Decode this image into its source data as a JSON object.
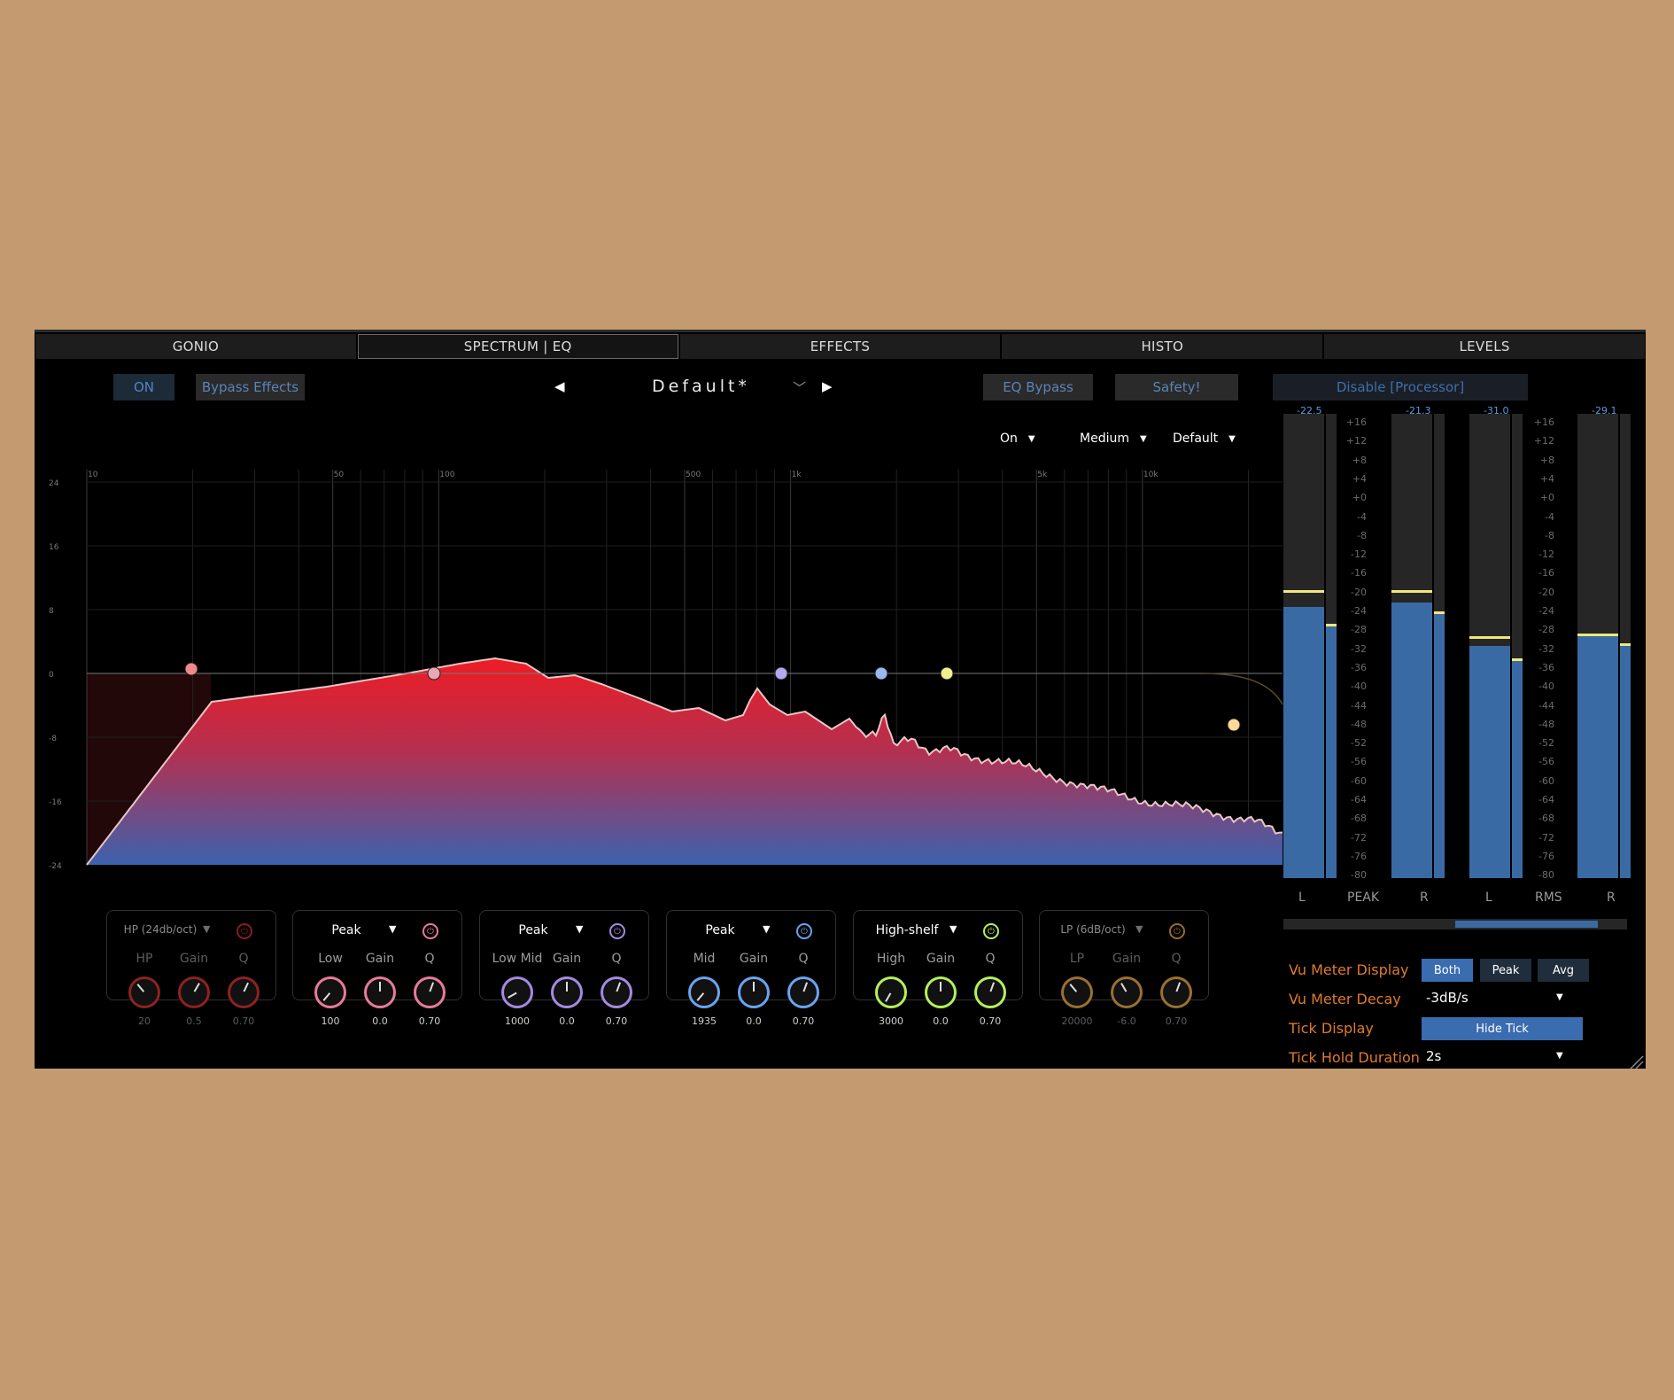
{
  "tabs": [
    "GONIO",
    "SPECTRUM | EQ",
    "EFFECTS",
    "HISTO",
    "LEVELS"
  ],
  "active_tab": "SPECTRUM | EQ",
  "toolbar": {
    "on_label": "ON",
    "bypass_effects_label": "Bypass Effects",
    "preset_name": "Default*",
    "eq_bypass_label": "EQ Bypass",
    "safety_label": "Safety!",
    "disable_processor_label": "Disable [Processor]"
  },
  "graph_options": {
    "mode": "On",
    "speed": "Medium",
    "style": "Default"
  },
  "eq_graph": {
    "x_ticks": [
      10,
      50,
      100,
      500,
      "1k",
      "5k",
      "10k"
    ],
    "y_ticks": [
      24,
      16,
      8,
      0,
      -8,
      -16,
      -24
    ],
    "colors": {
      "fill_top": "#e0222a",
      "fill_bottom": "#3c5fa8",
      "curve": "#e6c6c6"
    }
  },
  "bands": [
    {
      "type": "HP (24db/oct)",
      "enabled": false,
      "color": "#d02a2a",
      "labels": [
        "HP",
        "Gain",
        "Q"
      ],
      "values": [
        "20",
        "0.5",
        "0.70"
      ]
    },
    {
      "type": "Peak",
      "enabled": true,
      "color": "#e87a9a",
      "labels": [
        "Low",
        "Gain",
        "Q"
      ],
      "values": [
        "100",
        "0.0",
        "0.70"
      ]
    },
    {
      "type": "Peak",
      "enabled": true,
      "color": "#a48ae0",
      "labels": [
        "Low Mid",
        "Gain",
        "Q"
      ],
      "values": [
        "1000",
        "0.0",
        "0.70"
      ]
    },
    {
      "type": "Peak",
      "enabled": true,
      "color": "#6aa4f0",
      "labels": [
        "Mid",
        "Gain",
        "Q"
      ],
      "values": [
        "1935",
        "0.0",
        "0.70"
      ]
    },
    {
      "type": "High-shelf",
      "enabled": true,
      "color": "#b4f05a",
      "labels": [
        "High",
        "Gain",
        "Q"
      ],
      "values": [
        "3000",
        "0.0",
        "0.70"
      ]
    },
    {
      "type": "LP (6dB/oct)",
      "enabled": false,
      "color": "#e0a040",
      "labels": [
        "LP",
        "Gain",
        "Q"
      ],
      "values": [
        "20000",
        "-6.0",
        "0.70"
      ]
    }
  ],
  "levels": {
    "peak_values": [
      "-22.5",
      "-21.3"
    ],
    "rms_values": [
      "-31.0",
      "-29.1"
    ],
    "scale": [
      "+16",
      "+12",
      "+8",
      "+4",
      "+0",
      "-4",
      "-8",
      "-12",
      "-16",
      "-20",
      "-24",
      "-28",
      "-32",
      "-36",
      "-40",
      "-44",
      "-48",
      "-52",
      "-56",
      "-60",
      "-64",
      "-68",
      "-72",
      "-76",
      "-80"
    ],
    "labels": {
      "peak_l": "L",
      "peak": "PEAK",
      "peak_r": "R",
      "rms_l": "L",
      "rms": "RMS",
      "rms_r": "R"
    },
    "options": {
      "vu_display_label": "Vu Meter Display",
      "vu_display_options": [
        "Both",
        "Peak",
        "Avg"
      ],
      "vu_display_selected": "Both",
      "vu_decay_label": "Vu Meter Decay",
      "vu_decay_value": "-3dB/s",
      "tick_display_label": "Tick Display",
      "tick_display_value": "Hide Tick",
      "tick_hold_label": "Tick Hold Duration",
      "tick_hold_value": "2s"
    }
  }
}
